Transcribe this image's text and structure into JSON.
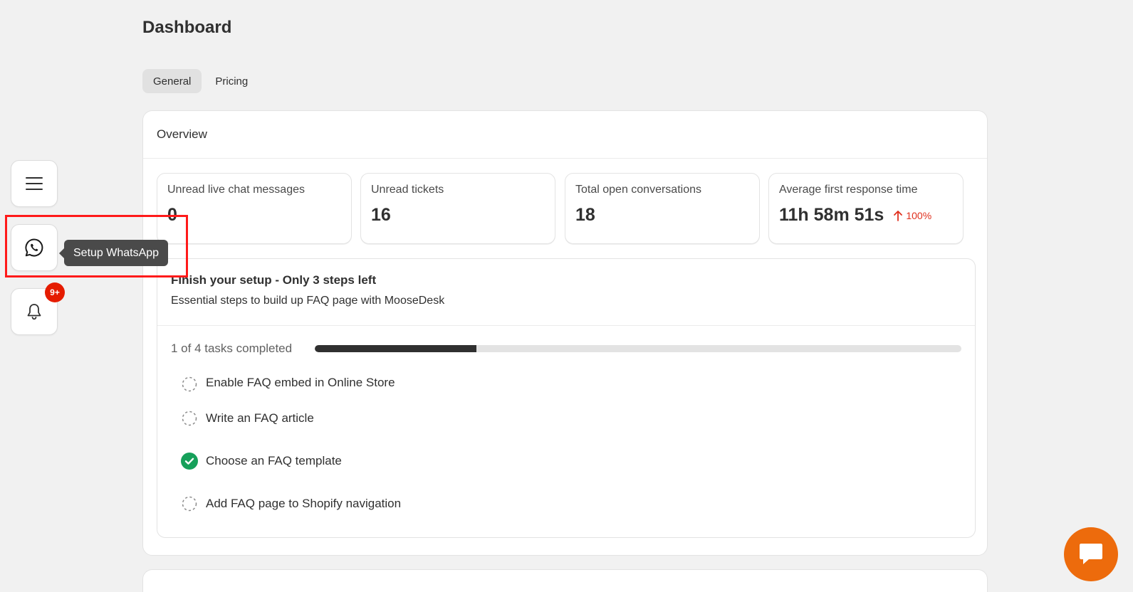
{
  "page": {
    "title": "Dashboard"
  },
  "tabs": [
    {
      "label": "General",
      "active": true
    },
    {
      "label": "Pricing",
      "active": false
    }
  ],
  "overview": {
    "title": "Overview",
    "stats": [
      {
        "label": "Unread live chat messages",
        "value": "0"
      },
      {
        "label": "Unread tickets",
        "value": "16"
      },
      {
        "label": "Total open conversations",
        "value": "18"
      },
      {
        "label": "Average first response time",
        "value": "11h 58m 51s",
        "change": "100%",
        "change_direction": "up"
      }
    ]
  },
  "setup": {
    "title": "Finish your setup - Only 3 steps left",
    "subtitle": "Essential steps to build up FAQ page with MooseDesk",
    "progress_label": "1 of 4 tasks completed",
    "completed": 1,
    "total": 4,
    "tasks": [
      {
        "label": "Enable FAQ embed in Online Store",
        "done": false
      },
      {
        "label": "Write an FAQ article",
        "done": false
      },
      {
        "label": "Choose an FAQ template",
        "done": true
      },
      {
        "label": "Add FAQ page to Shopify navigation",
        "done": false
      }
    ]
  },
  "sidebar": {
    "menu_icon": "hamburger-menu-icon",
    "whatsapp_icon": "whatsapp-icon",
    "whatsapp_tooltip": "Setup WhatsApp",
    "bell_icon": "bell-icon",
    "notification_badge": "9+"
  },
  "colors": {
    "accent_fab": "#ed6b0c",
    "badge": "#e51c00",
    "done_check": "#16a05a",
    "change_up": "#e0301e",
    "highlight": "#ff1a1a"
  }
}
